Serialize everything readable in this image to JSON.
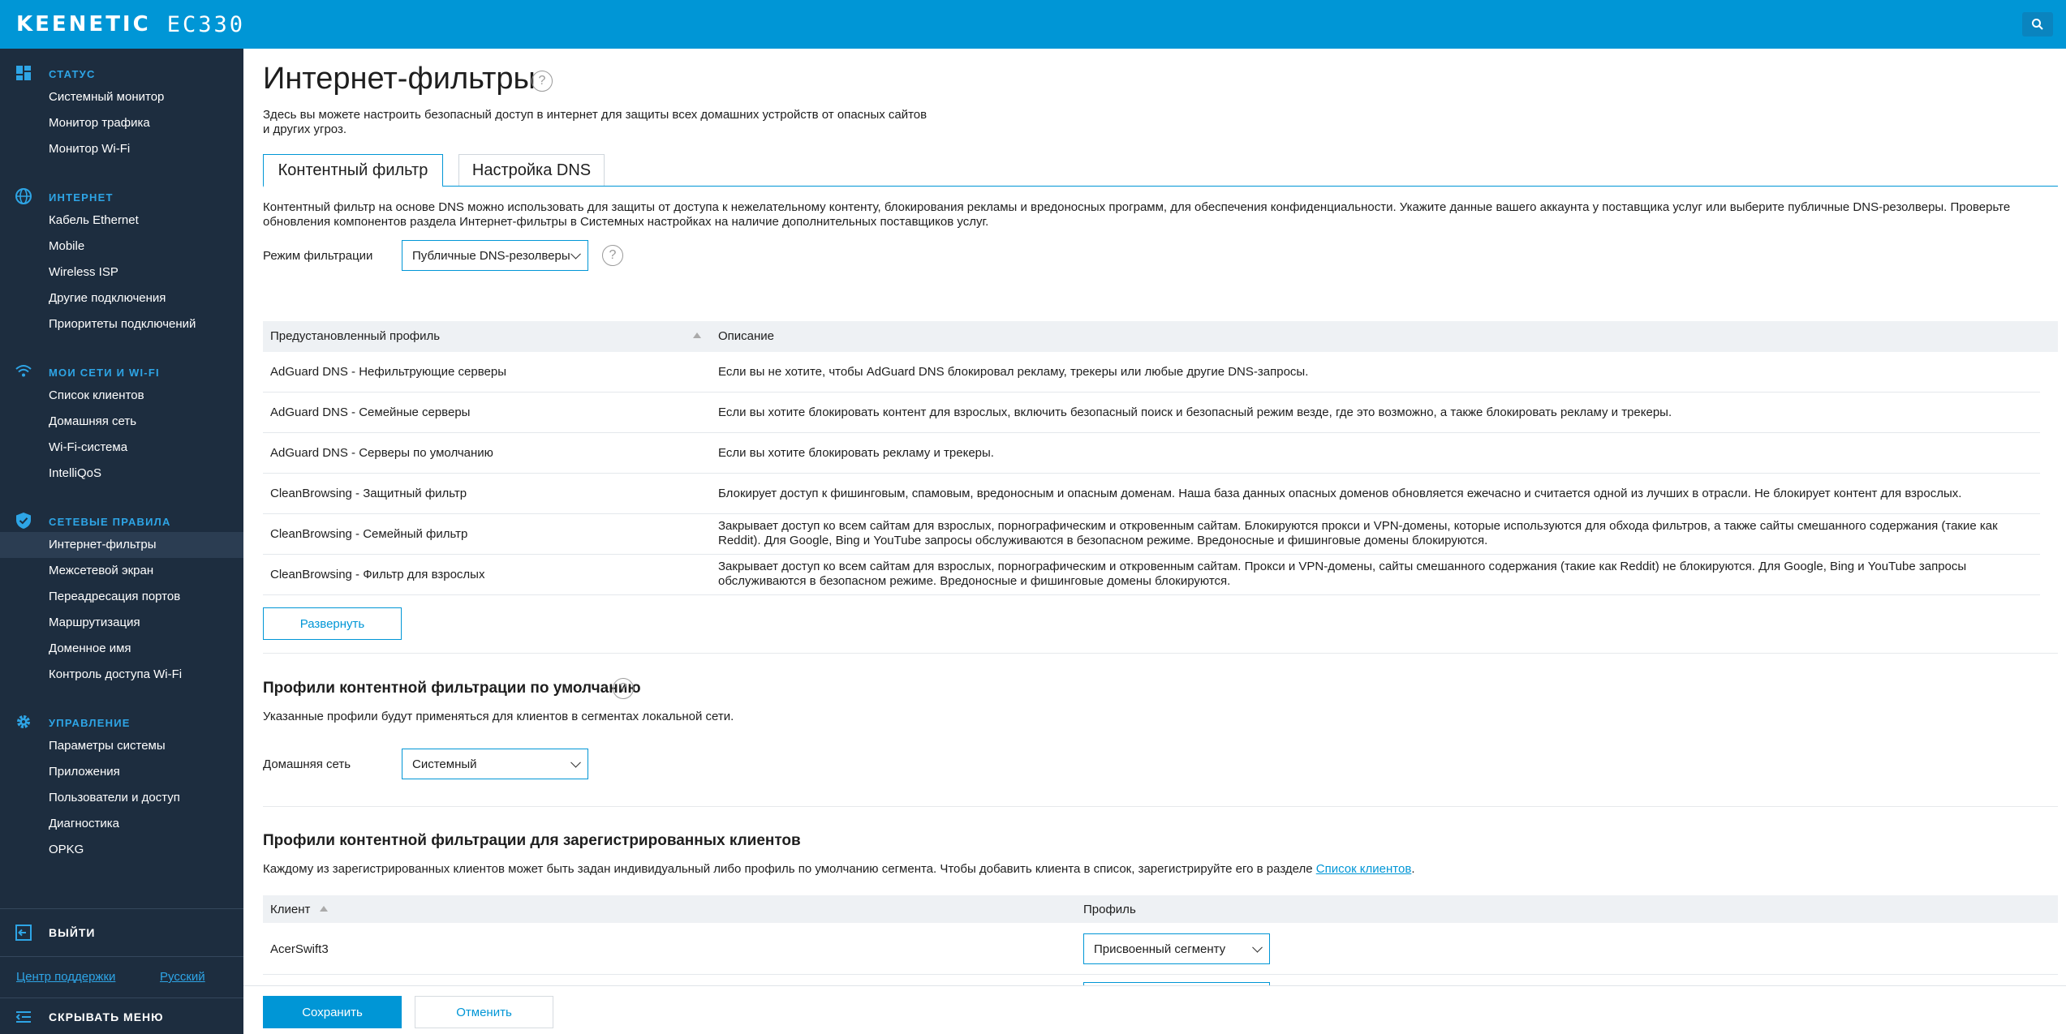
{
  "header": {
    "brand": "KEENETIC",
    "model": "EC330",
    "search_icon": "search-icon",
    "color": "#0096d6"
  },
  "sidebar": {
    "groups": [
      {
        "title": "СТАТУС",
        "icon": "dashboard-icon",
        "items": [
          "Системный монитор",
          "Монитор трафика",
          "Монитор Wi-Fi"
        ]
      },
      {
        "title": "ИНТЕРНЕТ",
        "icon": "globe-icon",
        "items": [
          "Кабель Ethernet",
          "Mobile",
          "Wireless ISP",
          "Другие подключения",
          "Приоритеты подключений"
        ]
      },
      {
        "title": "МОИ СЕТИ И WI-FI",
        "icon": "wifi-icon",
        "items": [
          "Список клиентов",
          "Домашняя сеть",
          "Wi-Fi-система",
          "IntelliQoS"
        ]
      },
      {
        "title": "СЕТЕВЫЕ ПРАВИЛА",
        "icon": "shield-icon",
        "items": [
          "Интернет-фильтры",
          "Межсетевой экран",
          "Переадресация портов",
          "Маршрутизация",
          "Доменное имя",
          "Контроль доступа Wi-Fi"
        ]
      },
      {
        "title": "УПРАВЛЕНИЕ",
        "icon": "gear-icon",
        "items": [
          "Параметры системы",
          "Приложения",
          "Пользователи и доступ",
          "Диагностика",
          "OPKG"
        ]
      }
    ],
    "active_item": "Интернет-фильтры",
    "exit_label": "ВЫЙТИ",
    "support_link": "Центр поддержки",
    "language_link": "Русский",
    "collapse_label": "СКРЫВАТЬ МЕНЮ",
    "color": "#1d2d3f",
    "accent": "#2ea5e6"
  },
  "page": {
    "title": "Интернет-фильтры",
    "intro": "Здесь вы можете настроить безопасный доступ в интернет для защиты всех домашних устройств от опасных сайтов и других угроз.",
    "tabs": [
      "Контентный фильтр",
      "Настройка DNS"
    ],
    "active_tab": "Контентный фильтр",
    "description": "Контентный фильтр на основе DNS можно использовать для защиты от доступа к нежелательному контенту, блокирования рекламы и вредоносных программ, для обеспечения конфиденциальности. Укажите данные вашего аккаунта у поставщика услуг или выберите публичные DNS-резолверы. Проверьте обновления компонентов раздела Интернет-фильтры в Системных настройках на наличие дополнительных поставщиков услуг.",
    "mode_label": "Режим фильтрации",
    "mode_value": "Публичные DNS-резолверы"
  },
  "profiles_table": {
    "columns": [
      "Предустановленный профиль",
      "Описание"
    ],
    "rows": [
      {
        "name": "AdGuard DNS - Нефильтрующие серверы",
        "description": "Если вы не хотите, чтобы AdGuard DNS блокировал рекламу, трекеры или любые другие DNS-запросы."
      },
      {
        "name": "AdGuard DNS - Семейные серверы",
        "description": "Если вы хотите блокировать контент для взрослых, включить безопасный поиск и безопасный режим везде, где это возможно, а также блокировать рекламу и трекеры."
      },
      {
        "name": "AdGuard DNS - Серверы по умолчанию",
        "description": "Если вы хотите блокировать рекламу и трекеры."
      },
      {
        "name": "CleanBrowsing - Защитный фильтр",
        "description": "Блокирует доступ к фишинговым, спамовым, вредоносным и опасным доменам. Наша база данных опасных доменов обновляется ежечасно и считается одной из лучших в отрасли. Не блокирует контент для взрослых."
      },
      {
        "name": "CleanBrowsing - Семейный фильтр",
        "description": "Закрывает доступ ко всем сайтам для взрослых, порнографическим и откровенным сайтам. Блокируются прокси и VPN-домены, которые используются для обхода фильтров, а также сайты смешанного содержания (такие как Reddit). Для Google, Bing и YouTube запросы обслуживаются в безопасном режиме. Вредоносные и фишинговые домены блокируются."
      },
      {
        "name": "CleanBrowsing - Фильтр для взрослых",
        "description": "Закрывает доступ ко всем сайтам для взрослых, порнографическим и откровенным сайтам. Прокси и VPN-домены, сайты смешанного содержания (такие как Reddit) не блокируются. Для Google, Bing и YouTube запросы обслуживаются в безопасном режиме. Вредоносные и фишинговые домены блокируются."
      }
    ],
    "expand_label": "Развернуть"
  },
  "default_profiles": {
    "title": "Профили контентной фильтрации по умолчанию",
    "note": "Указанные профили будут применяться для клиентов в сегментах локальной сети.",
    "segment_label": "Домашняя сеть",
    "segment_value": "Системный"
  },
  "client_profiles": {
    "title": "Профили контентной фильтрации для зарегистрированных клиентов",
    "note": "Каждому из зарегистрированных клиентов может быть задан индивидуальный либо профиль по умолчанию сегмента. Чтобы добавить клиента в список, зарегистрируйте его в разделе",
    "note_link": "Список клиентов",
    "columns": [
      "Клиент",
      "Профиль"
    ],
    "rows": [
      {
        "client": "AcerSwift3",
        "profile": "Присвоенный сегменту"
      }
    ]
  },
  "actions": {
    "save": "Сохранить",
    "cancel": "Отменить"
  }
}
